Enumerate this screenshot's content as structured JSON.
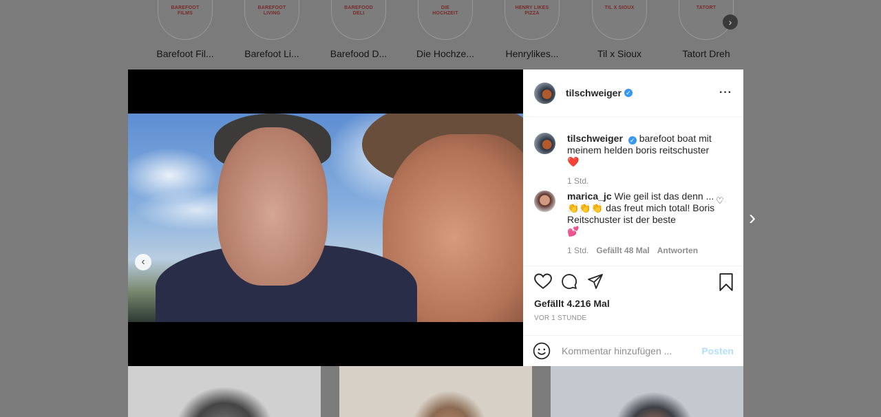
{
  "highlights": {
    "items": [
      {
        "badge": "BAREFOOT\nFILMS",
        "label": "Barefoot Fil..."
      },
      {
        "badge": "BAREFOOT\nLIVING",
        "label": "Barefoot Li..."
      },
      {
        "badge": "BAREFOOD\nDELI",
        "label": "Barefood D..."
      },
      {
        "badge": "DIE\nHOCHZEIT",
        "label": "Die Hochze..."
      },
      {
        "badge": "HENRY LIKES\nPIZZA",
        "label": "Henrylikes..."
      },
      {
        "badge": "TIL X SIOUX",
        "label": "Til x Sioux"
      },
      {
        "badge": "TATORT",
        "label": "Tatort Dreh"
      }
    ],
    "next_icon": "chevron-right-icon"
  },
  "post": {
    "author": "tilschweiger",
    "more_icon": "more-horizontal-icon",
    "caption": {
      "user": "tilschweiger",
      "text": "barefoot boat mit meinem helden boris reitschuster",
      "emoji": "❤️",
      "time": "1 Std."
    },
    "comment": {
      "user": "marica_jc",
      "text": "Wie geil ist das denn ... 👏👏👏 das freut mich total! Boris Reitschuster ist der beste",
      "emoji": "💕",
      "time": "1 Std.",
      "likes": "Gefällt 48 Mal",
      "reply": "Antworten"
    },
    "likes": "Gefällt 4.216 Mal",
    "timestamp": "VOR 1 STUNDE",
    "comment_placeholder": "Kommentar hinzufügen ...",
    "post_button": "Posten",
    "carousel": {
      "slides": 2,
      "active": 2
    }
  },
  "colors": {
    "verified": "#3897f0",
    "post_button_disabled": "#b2dffc",
    "overlay": "#7b7b7b"
  }
}
